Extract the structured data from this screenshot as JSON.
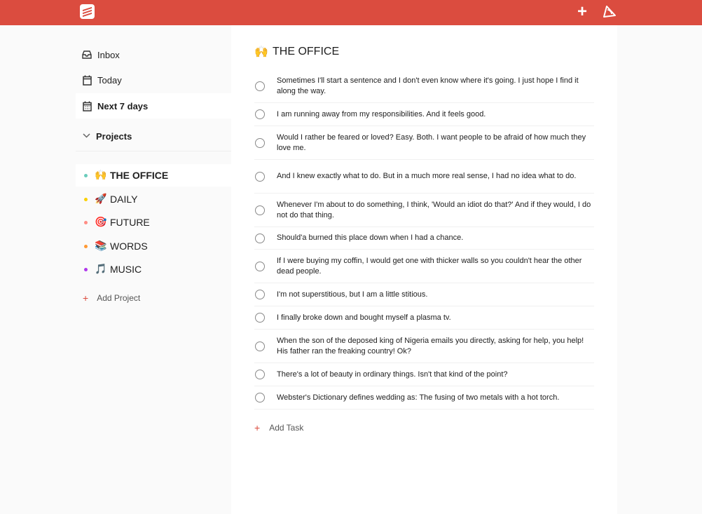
{
  "header": {
    "add_icon_glyph": "+",
    "accent": "#db4c3f"
  },
  "sidebar": {
    "filters": [
      {
        "label": "Inbox",
        "icon": "inbox-icon"
      },
      {
        "label": "Today",
        "icon": "calendar-icon"
      },
      {
        "label": "Next 7 days",
        "icon": "calendar-week-icon"
      }
    ],
    "projects_label": "Projects",
    "projects": [
      {
        "emoji": "🙌",
        "label": "THE OFFICE",
        "color": "#6accbc"
      },
      {
        "emoji": "🚀",
        "label": "DAILY",
        "color": "#fad000"
      },
      {
        "emoji": "🎯",
        "label": "FUTURE",
        "color": "#ff8d85"
      },
      {
        "emoji": "📚",
        "label": "WORDS",
        "color": "#ff9933"
      },
      {
        "emoji": "🎵",
        "label": "MUSIC",
        "color": "#af38eb"
      }
    ],
    "add_project_label": "Add Project"
  },
  "main": {
    "title_emoji": "🙌",
    "title": "THE OFFICE",
    "tasks": [
      "Sometimes I'll start a sentence and I don't even know where it's going. I just hope I find it along the way.",
      "I am running away from my responsibilities. And it feels good.",
      "Would I rather be feared or loved? Easy. Both. I want people to be afraid of how much they love me.",
      "And I knew exactly what to do. But in a much more real sense, I had no idea what to do.",
      "Whenever I'm about to do something, I think, 'Would an idiot do that?' And if they would, I do not do that thing.",
      "Should'a burned this place down when I had a chance.",
      "If I were buying my coffin, I would get one with thicker walls so you couldn't hear the other dead people.",
      "I'm not superstitious, but I am a little stitious.",
      "I finally broke down and bought myself a plasma tv.",
      "When the son of the deposed king of Nigeria emails you directly, asking for help, you help! His father ran the freaking country! Ok?",
      "There's a lot of beauty in ordinary things. Isn't that kind of the point?",
      "Webster's Dictionary defines wedding as: The fusing of two metals with a hot torch."
    ],
    "add_task_label": "Add Task"
  }
}
